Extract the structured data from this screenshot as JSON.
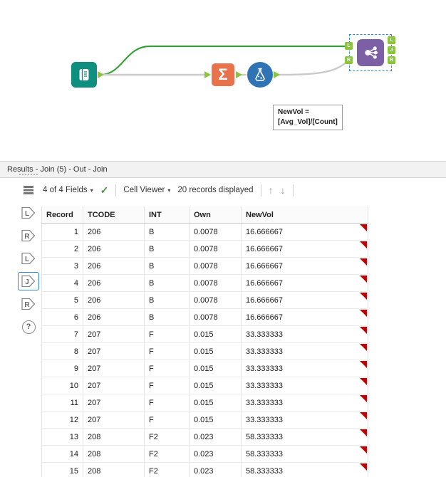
{
  "canvas": {
    "tools": {
      "input_icon": "book-icon",
      "summarize_glyph": "Σ",
      "formula_icon": "flask-icon",
      "join_icon": "join-nodes-icon"
    },
    "join_anchors": {
      "left_top": "L",
      "left_bottom": "R",
      "right_top": "L",
      "right_mid": "J",
      "right_bottom": "R"
    },
    "annotation": {
      "line1": "NewVol =",
      "line2": "[Avg_Vol]/[Count]"
    }
  },
  "icons": {
    "caret_down": "▾",
    "check": "✓",
    "arrow_up": "↑",
    "arrow_down": "↓"
  },
  "results": {
    "title": "Results - Join (5) - Out - Join",
    "toolbar": {
      "fields_label": "4 of 4 Fields",
      "cell_viewer_label": "Cell Viewer",
      "records_label": "20 records displayed"
    },
    "sidebar": {
      "in_left": "L",
      "in_right": "R",
      "out_left": "L",
      "out_join": "J",
      "out_right": "R",
      "help": "?"
    },
    "table": {
      "columns": [
        "Record",
        "TCODE",
        "INT",
        "Own",
        "NewVol"
      ],
      "rows": [
        [
          "1",
          "206",
          "B",
          "0.0078",
          "16.666667"
        ],
        [
          "2",
          "206",
          "B",
          "0.0078",
          "16.666667"
        ],
        [
          "3",
          "206",
          "B",
          "0.0078",
          "16.666667"
        ],
        [
          "4",
          "206",
          "B",
          "0.0078",
          "16.666667"
        ],
        [
          "5",
          "206",
          "B",
          "0.0078",
          "16.666667"
        ],
        [
          "6",
          "206",
          "B",
          "0.0078",
          "16.666667"
        ],
        [
          "7",
          "207",
          "F",
          "0.015",
          "33.333333"
        ],
        [
          "8",
          "207",
          "F",
          "0.015",
          "33.333333"
        ],
        [
          "9",
          "207",
          "F",
          "0.015",
          "33.333333"
        ],
        [
          "10",
          "207",
          "F",
          "0.015",
          "33.333333"
        ],
        [
          "11",
          "207",
          "F",
          "0.015",
          "33.333333"
        ],
        [
          "12",
          "207",
          "F",
          "0.015",
          "33.333333"
        ],
        [
          "13",
          "208",
          "F2",
          "0.023",
          "58.333333"
        ],
        [
          "14",
          "208",
          "F2",
          "0.023",
          "58.333333"
        ],
        [
          "15",
          "208",
          "F2",
          "0.023",
          "58.333333"
        ]
      ]
    }
  },
  "colors": {
    "input_teal": "#0e8f80",
    "summarize_orange": "#e8724c",
    "formula_blue": "#2e74b5",
    "join_purple": "#7d5fa5",
    "anchor_green": "#8bc53f",
    "wire_green": "#3aa13a",
    "selection_blue": "#2e86d6",
    "flag_red": "#c00000"
  }
}
